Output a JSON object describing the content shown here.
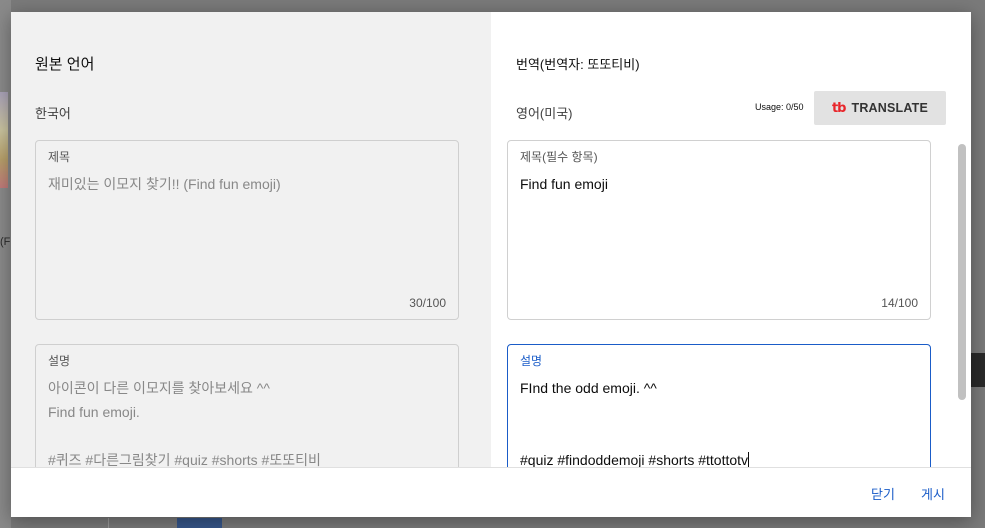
{
  "background": {
    "left_fragment": "(F"
  },
  "dialog": {
    "source": {
      "title": "원본 언어",
      "language": "한국어",
      "title_field": {
        "label": "제목",
        "value": "재미있는 이모지 찾기!! (Find fun emoji)",
        "count": "30/100"
      },
      "description_field": {
        "label": "설명",
        "value": "아이콘이 다른 이모지를 찾아보세요 ^^\nFind fun emoji.\n\n#퀴즈 #다른그림찾기 #quiz #shorts #또또티비"
      }
    },
    "target": {
      "title": "번역(번역자: 또또티비)",
      "language": "영어(미국)",
      "usage": "Usage: 0/50",
      "translate_button": {
        "logo": "tb",
        "label": "TRANSLATE"
      },
      "title_field": {
        "label": "제목(필수 항목)",
        "value": "Find fun emoji",
        "count": "14/100"
      },
      "description_field": {
        "label": "설명",
        "value": "FInd the odd emoji. ^^\n\n\n#quiz #findoddemoji #shorts #ttottotv"
      }
    },
    "footer": {
      "close_label": "닫기",
      "publish_label": "게시"
    }
  },
  "colors": {
    "accent": "#1a5cc8",
    "translate_logo": "#e8262b",
    "source_panel_bg": "#f1f1f1"
  }
}
